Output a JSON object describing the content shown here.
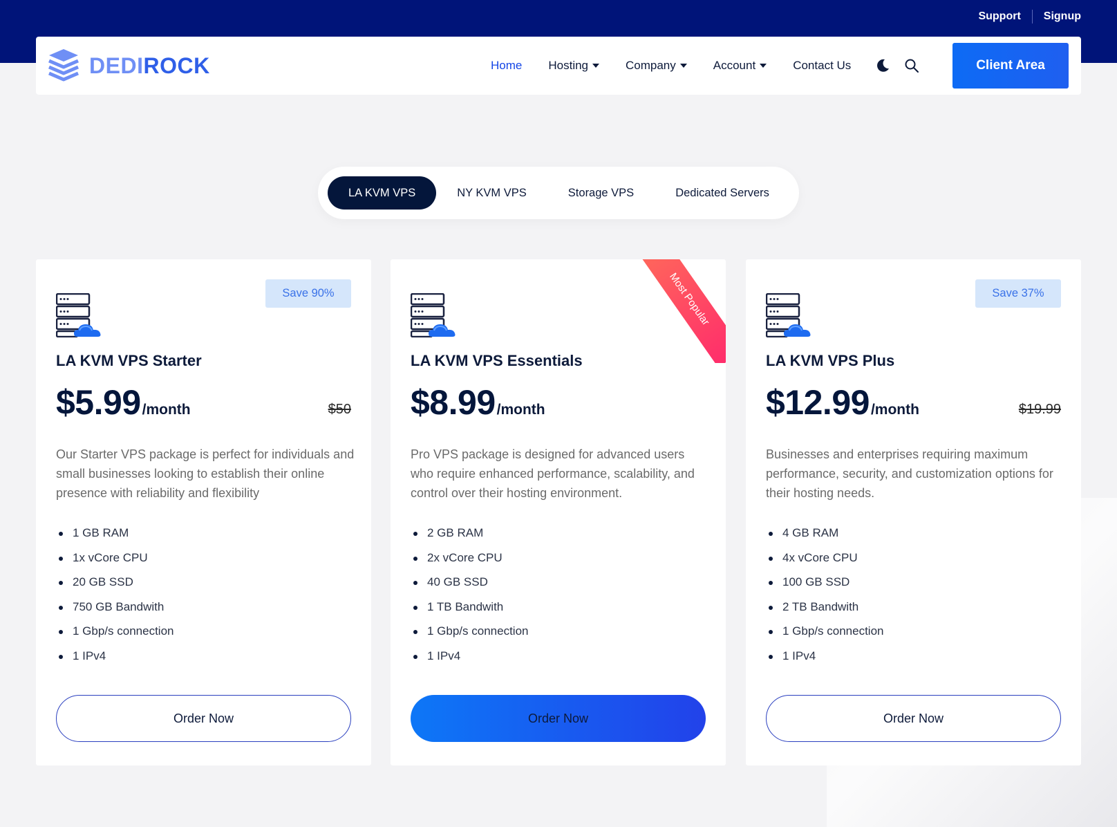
{
  "top_links": [
    {
      "label": "Support"
    },
    {
      "label": "Signup"
    }
  ],
  "brand": {
    "part1": "DEDI",
    "part2": "ROCK"
  },
  "nav": {
    "items": [
      {
        "label": "Home"
      },
      {
        "label": "Hosting"
      },
      {
        "label": "Company"
      },
      {
        "label": "Account"
      },
      {
        "label": "Contact Us"
      }
    ],
    "client_area_label": "Client Area"
  },
  "tabs": [
    {
      "label": "LA KVM VPS"
    },
    {
      "label": "NY KVM VPS"
    },
    {
      "label": "Storage VPS"
    },
    {
      "label": "Dedicated Servers"
    }
  ],
  "plans": [
    {
      "badge": "Save 90%",
      "name": "LA KVM VPS Starter",
      "price": "$5.99",
      "period": "/month",
      "old_price": "$50",
      "description": "Our Starter VPS package is perfect for individuals and small businesses looking to establish their online presence with reliability and flexibility",
      "features": [
        "1 GB RAM",
        "1x vCore CPU",
        "20 GB SSD",
        "750 GB Bandwith",
        "1 Gbp/s connection",
        "1 IPv4"
      ],
      "button": "Order Now"
    },
    {
      "ribbon": "Most Popular",
      "name": "LA KVM VPS Essentials",
      "price": "$8.99",
      "period": "/month",
      "description": "Pro VPS package is designed for advanced users who require enhanced performance, scalability, and control over their hosting environment.",
      "features": [
        "2 GB RAM",
        "2x vCore CPU",
        "40 GB SSD",
        "1 TB Bandwith",
        "1 Gbp/s connection",
        "1 IPv4"
      ],
      "button": "Order Now"
    },
    {
      "badge": "Save 37%",
      "name": "LA KVM VPS Plus",
      "price": "$12.99",
      "period": "/month",
      "old_price": "$19.99",
      "description": "Businesses and enterprises requiring maximum performance, security, and customization options for their hosting needs.",
      "features": [
        "4 GB RAM",
        "4x vCore CPU",
        "100 GB SSD",
        "2 TB Bandwith",
        "1 Gbp/s connection",
        "1 IPv4"
      ],
      "button": "Order Now"
    }
  ],
  "colors": {
    "top_band": "#001479",
    "accent": "#1546e6",
    "tab_active": "#04163b",
    "badge_bg": "#d5e6fb",
    "ribbon": "#ff2d6b"
  }
}
